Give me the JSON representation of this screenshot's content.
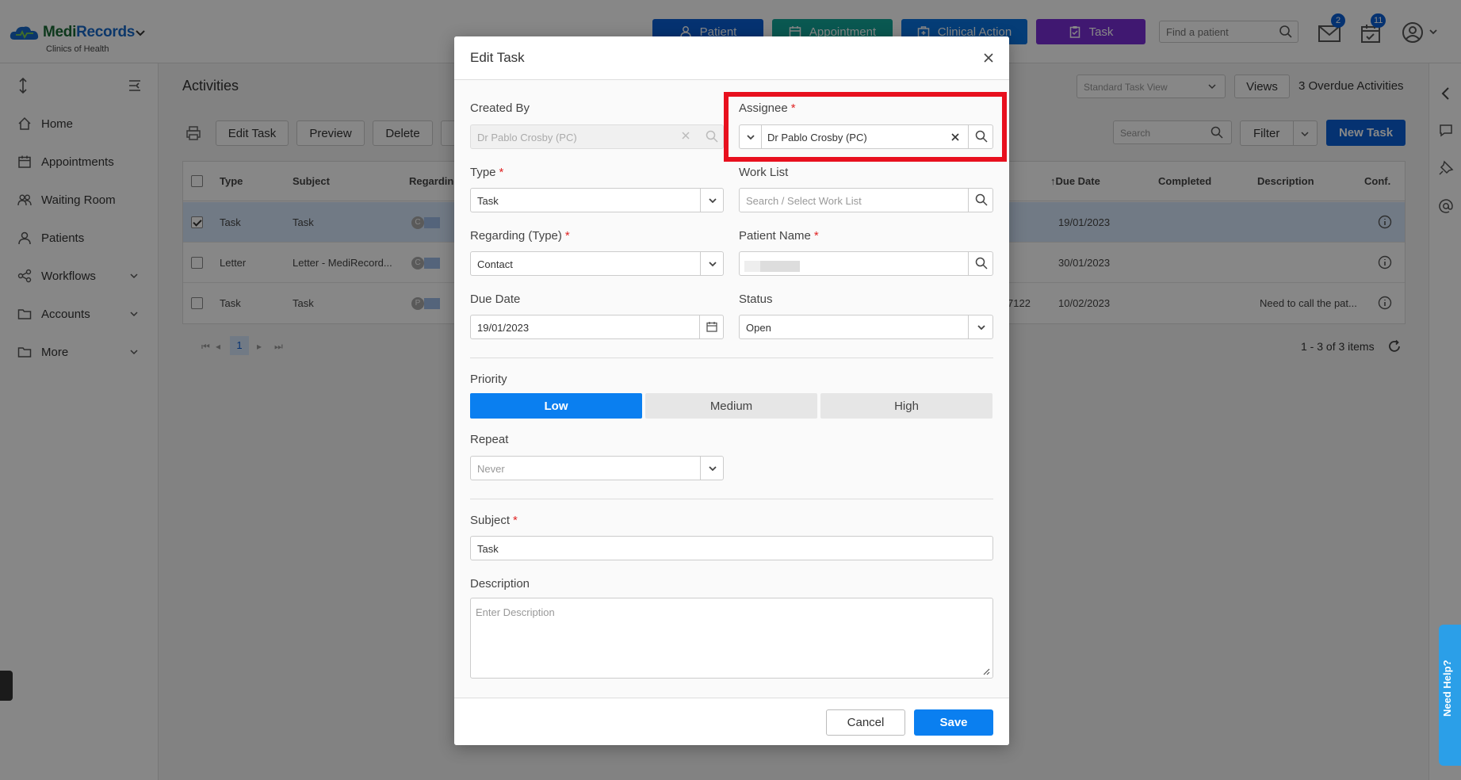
{
  "app": {
    "brand_main": "Medi",
    "brand_accent": "Records",
    "brand_sub": "Clinics of Health"
  },
  "header": {
    "buttons": {
      "patient": "Patient",
      "appointment": "Appointment",
      "clinical_action": "Clinical Action",
      "task": "Task"
    },
    "find_patient_placeholder": "Find a patient",
    "mail_badge": "2",
    "tasks_badge": "11"
  },
  "sidebar": {
    "items": [
      {
        "label": "Home",
        "icon": "home-icon"
      },
      {
        "label": "Appointments",
        "icon": "calendar-icon"
      },
      {
        "label": "Waiting Room",
        "icon": "people-icon"
      },
      {
        "label": "Patients",
        "icon": "user-icon"
      },
      {
        "label": "Workflows",
        "icon": "workflow-icon"
      },
      {
        "label": "Accounts",
        "icon": "folder-icon"
      },
      {
        "label": "More",
        "icon": "folder-icon"
      }
    ]
  },
  "main": {
    "title": "Activities",
    "view_select": "Standard Task View",
    "views_label": "Views",
    "overdue": "3 Overdue Activities",
    "toolbar": {
      "edit_task": "Edit Task",
      "preview": "Preview",
      "delete": "Delete"
    },
    "search_placeholder": "Search",
    "filter_label": "Filter",
    "new_task_label": "New Task",
    "columns": {
      "type": "Type",
      "subject": "Subject",
      "regarding": "Regarding",
      "due_date": "↑Due Date",
      "completed": "Completed",
      "description": "Description",
      "conf": "Conf."
    },
    "rows": [
      {
        "type": "Task",
        "subject": "Task",
        "avatar": "C",
        "extra": "",
        "due": "19/01/2023",
        "description": "",
        "selected": true
      },
      {
        "type": "Letter",
        "subject": "Letter - MediRecord...",
        "avatar": "C",
        "extra": "",
        "due": "30/01/2023",
        "description": "",
        "selected": false
      },
      {
        "type": "Task",
        "subject": "Task",
        "avatar": "P",
        "extra": "7122",
        "due": "10/02/2023",
        "description": "Need to call the pat...",
        "selected": false
      }
    ],
    "pager": {
      "current_page": "1",
      "count_text": "1 - 3 of 3 items"
    }
  },
  "modal": {
    "title": "Edit Task",
    "created_by": {
      "label": "Created By",
      "value": "Dr Pablo Crosby (PC)"
    },
    "assignee": {
      "label": "Assignee",
      "value": "Dr Pablo Crosby (PC)"
    },
    "type": {
      "label": "Type",
      "value": "Task"
    },
    "work_list": {
      "label": "Work List",
      "placeholder": "Search / Select Work List"
    },
    "regarding_type": {
      "label": "Regarding (Type)",
      "value": "Contact"
    },
    "patient_name": {
      "label": "Patient Name"
    },
    "due_date": {
      "label": "Due Date",
      "value": "19/01/2023"
    },
    "status": {
      "label": "Status",
      "value": "Open"
    },
    "priority": {
      "label": "Priority",
      "options": [
        "Low",
        "Medium",
        "High"
      ],
      "selected": "Low"
    },
    "repeat": {
      "label": "Repeat",
      "value": "Never"
    },
    "subject": {
      "label": "Subject",
      "value": "Task"
    },
    "description": {
      "label": "Description",
      "placeholder": "Enter Description"
    },
    "cancel_label": "Cancel",
    "save_label": "Save",
    "required_mark": "*"
  },
  "help_tab": "Need Help?",
  "colors": {
    "primary": "#0a5fd6",
    "highlight": "#e8101e",
    "task_purple": "#7a2fd6",
    "appointment_teal": "#14a79a"
  }
}
